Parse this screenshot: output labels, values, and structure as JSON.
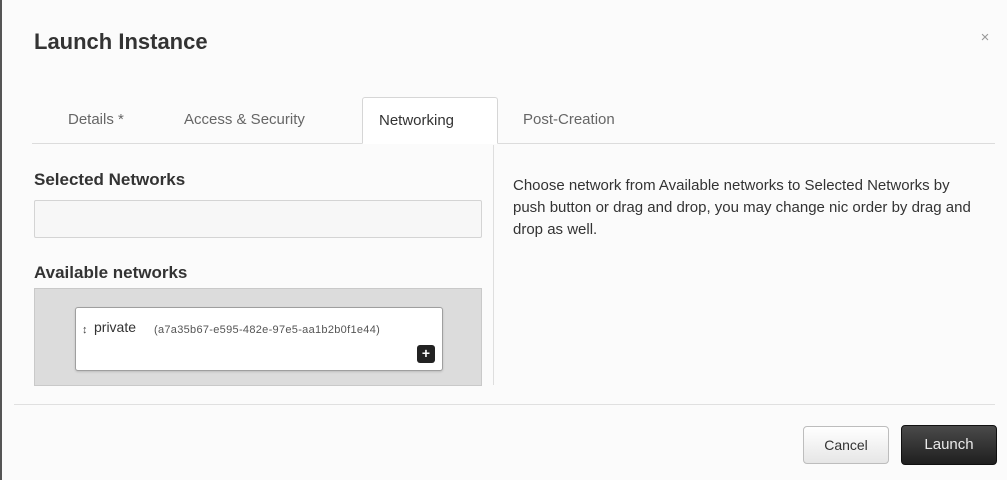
{
  "modal": {
    "title": "Launch Instance",
    "close_label": "×"
  },
  "tabs": [
    {
      "label": "Details *",
      "active": false
    },
    {
      "label": "Access & Security",
      "active": false
    },
    {
      "label": "Networking",
      "active": true
    },
    {
      "label": "Post-Creation",
      "active": false
    }
  ],
  "networking": {
    "selected_title": "Selected Networks",
    "available_title": "Available networks",
    "available": [
      {
        "name": "private",
        "id": "(a7a35b67-e595-482e-97e5-aa1b2b0f1e44)",
        "drag_glyph": "↕",
        "add_label": "+"
      }
    ],
    "help": "Choose network from Available networks to Selected Networks by push button or drag and drop, you may change nic order by drag and drop as well."
  },
  "footer": {
    "cancel_label": "Cancel",
    "launch_label": "Launch"
  }
}
